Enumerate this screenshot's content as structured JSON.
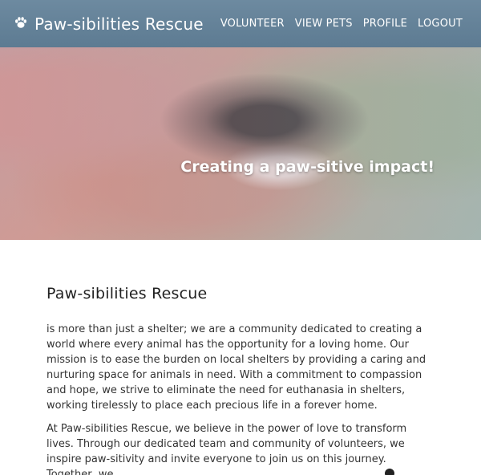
{
  "brand": {
    "name": "Paw-sibilities Rescue",
    "icon": "paw-icon"
  },
  "nav": [
    {
      "label": "VOLUNTEER"
    },
    {
      "label": "VIEW PETS"
    },
    {
      "label": "PROFILE"
    },
    {
      "label": "LOGOUT"
    }
  ],
  "hero": {
    "title": "Creating a paw-sitive impact!"
  },
  "about": {
    "title": "Paw-sibilities Rescue",
    "p1": "is more than just a shelter; we are a community dedicated to creating a world where every animal has the opportunity for a loving home. Our mission is to ease the burden on local shelters by providing a caring and nurturing space for animals in need. With a commitment to compassion and hope, we strive to eliminate the need for euthanasia in shelters, working tirelessly to place each precious life in a forever home.",
    "p2": "At Paw-sibilities Rescue, we believe in the power of love to transform lives. Through our dedicated team and community of volunteers, we inspire paw-sitivity and invite everyone to join us on this journey. Together, we"
  },
  "colors": {
    "navbar": "#6d8aa0",
    "text": "#333333"
  }
}
